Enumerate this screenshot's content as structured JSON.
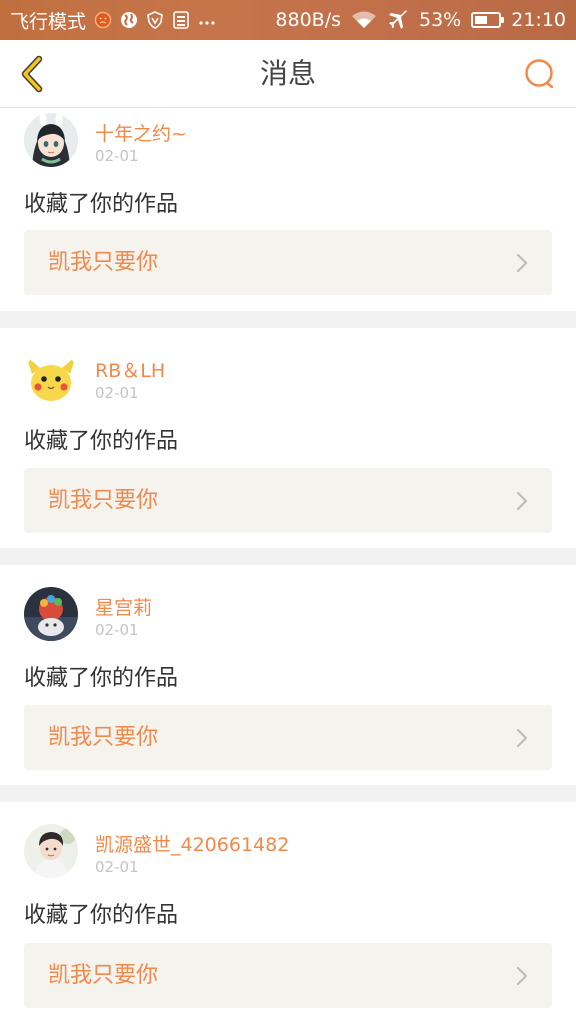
{
  "status_bar": {
    "mode": "飞行模式",
    "speed": "880B/s",
    "battery_pct": "53%",
    "battery_level": 0.53,
    "time": "21:10",
    "left_icons": [
      "face-icon",
      "globe-icon",
      "shield-icon",
      "sim-icon",
      "more-dots-icon"
    ],
    "right_icons": [
      "wifi-icon",
      "airplane-icon",
      "battery-icon"
    ]
  },
  "nav": {
    "title": "消息",
    "back_icon": "chevron-left-icon",
    "search_icon": "search-icon",
    "accent": "#f08a4b",
    "back_color": "#f5c518"
  },
  "messages": [
    {
      "username": "十年之约~",
      "date": "02-01",
      "action": "收藏了你的作品",
      "work_title": "凯我只要你",
      "avatar": "anime-girl-avatar"
    },
    {
      "username": "RB＆LH",
      "date": "02-01",
      "action": "收藏了你的作品",
      "work_title": "凯我只要你",
      "avatar": "pikachu-avatar"
    },
    {
      "username": "星宫莉",
      "date": "02-01",
      "action": "收藏了你的作品",
      "work_title": "凯我只要你",
      "avatar": "figure-avatar"
    },
    {
      "username": "凯源盛世_420661482",
      "date": "02-01",
      "action": "收藏了你的作品",
      "work_title": "凯我只要你",
      "avatar": "boy-avatar"
    }
  ],
  "colors": {
    "username": "#f08a4b",
    "work_title": "#f08a4b",
    "date": "#c4c4c4",
    "work_box_bg": "#f4f3ee",
    "separator": "#f2f2f2"
  }
}
